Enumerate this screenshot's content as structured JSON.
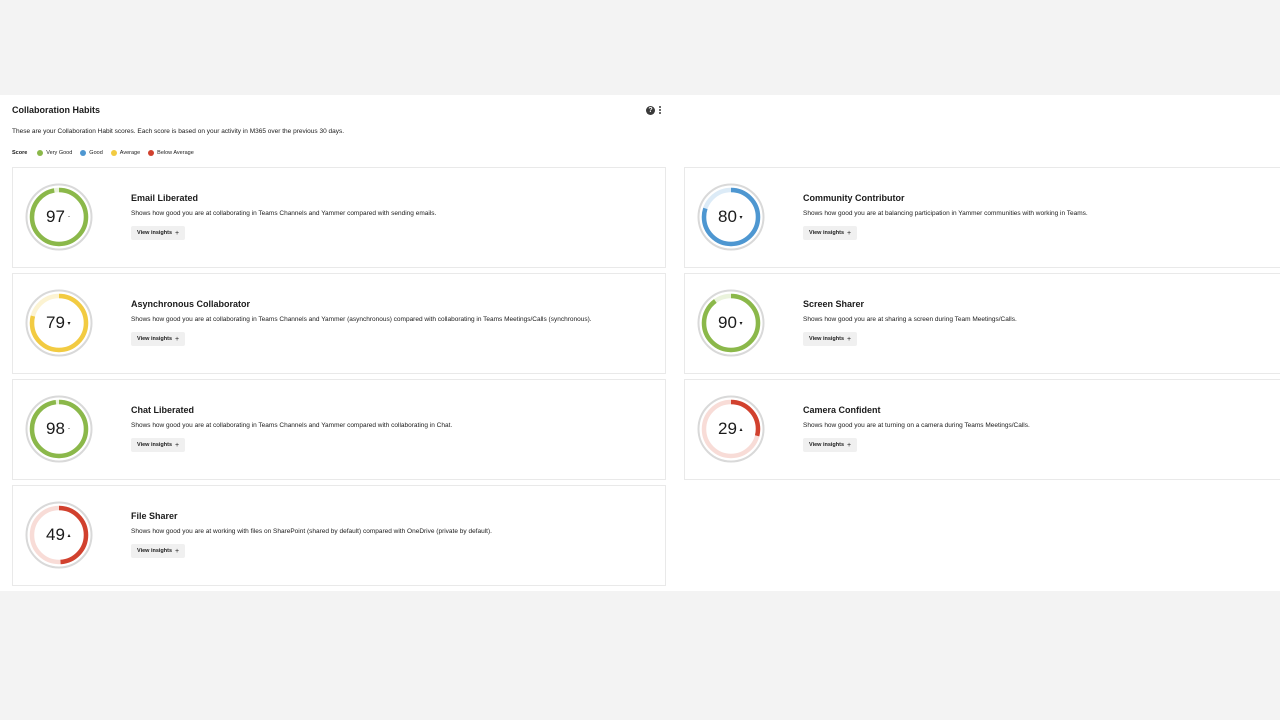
{
  "panel": {
    "title": "Collaboration Habits",
    "description": "These are your Collaboration Habit scores. Each score is based on your activity in M365 over the previous 30 days.",
    "help_icon": "help-circle-icon",
    "more_icon": "more-vertical-icon",
    "help_glyph": "?"
  },
  "legend": {
    "label": "Score",
    "items": [
      {
        "label": "Very Good",
        "color": "#8bb84a"
      },
      {
        "label": "Good",
        "color": "#4e97d1"
      },
      {
        "label": "Average",
        "color": "#f2cb42"
      },
      {
        "label": "Below Average",
        "color": "#d1412e"
      }
    ]
  },
  "cards": [
    {
      "title": "Email Liberated",
      "score": "97",
      "trend": "-",
      "level": "very_good",
      "progress": 0.97,
      "description": "Shows how good you are at collaborating in Teams Channels and Yammer compared with sending emails.",
      "button": "View insights",
      "button_icon": "+"
    },
    {
      "title": "Asynchronous Collaborator",
      "score": "79",
      "trend": "▾",
      "level": "average",
      "progress": 0.79,
      "description": "Shows how good you are at collaborating in Teams Channels and Yammer (asynchronous) compared with collaborating in Teams Meetings/Calls (synchronous).",
      "button": "View insights",
      "button_icon": "+"
    },
    {
      "title": "Chat Liberated",
      "score": "98",
      "trend": "-",
      "level": "very_good",
      "progress": 0.98,
      "description": "Shows how good you are at collaborating in Teams Channels and Yammer compared with collaborating in Chat.",
      "button": "View insights",
      "button_icon": "+"
    },
    {
      "title": "File Sharer",
      "score": "49",
      "trend": "▴",
      "level": "below_average",
      "progress": 0.49,
      "description": "Shows how good you are at working with files on SharePoint (shared by default) compared with OneDrive (private by default).",
      "button": "View insights",
      "button_icon": "+"
    },
    {
      "title": "Community Contributor",
      "score": "80",
      "trend": "▾",
      "level": "good",
      "progress": 0.8,
      "description": "Shows how good you are at balancing participation in Yammer communities with working in Teams.",
      "button": "View insights",
      "button_icon": "+"
    },
    {
      "title": "Screen Sharer",
      "score": "90",
      "trend": "▾",
      "level": "very_good",
      "progress": 0.9,
      "description": "Shows how good you are at sharing a screen during Team Meetings/Calls.",
      "button": "View insights",
      "button_icon": "+"
    },
    {
      "title": "Camera Confident",
      "score": "29",
      "trend": "▴",
      "level": "below_average",
      "progress": 0.29,
      "description": "Shows how good you are at turning on a camera during Teams Meetings/Calls.",
      "button": "View insights",
      "button_icon": "+"
    }
  ],
  "level_colors": {
    "very_good": {
      "arc": "#8bb84a",
      "track": "#eaf3dc"
    },
    "good": {
      "arc": "#4e97d1",
      "track": "#dcebf7"
    },
    "average": {
      "arc": "#f2cb42",
      "track": "#fcf3d2"
    },
    "below_average": {
      "arc": "#d1412e",
      "track": "#f8dcd7"
    }
  }
}
